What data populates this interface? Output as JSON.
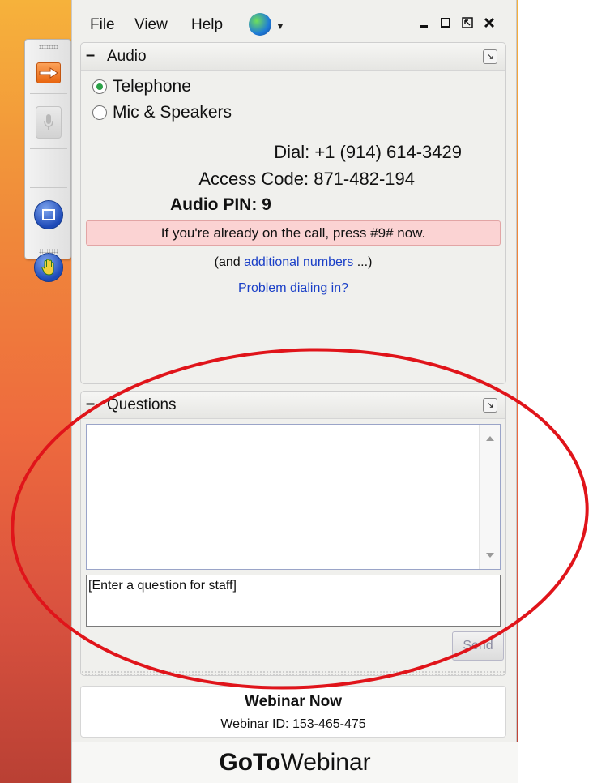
{
  "menubar": {
    "file": "File",
    "view": "View",
    "help": "Help"
  },
  "audio": {
    "title": "Audio",
    "options": [
      "Telephone",
      "Mic & Speakers"
    ],
    "selected": "Telephone",
    "dial": "Dial: +1 (914) 614-3429",
    "access_code": "Access Code: 871-482-194",
    "pin": "Audio PIN: 9",
    "alert": "If you're already on the call, press #9# now.",
    "additional_prefix": "(and ",
    "additional_link": "additional numbers",
    "additional_suffix": " ...)",
    "problem_link": "Problem dialing in?"
  },
  "questions": {
    "title": "Questions",
    "input_value": "[Enter a question for staff]",
    "send_label": "Send"
  },
  "webinar": {
    "title": "Webinar Now",
    "id": "Webinar ID: 153-465-475"
  },
  "brand": {
    "goto": "GoTo",
    "webinar": "Webinar"
  },
  "colors": {
    "accent_orange": "#e8650f",
    "link_blue": "#1a3fc7",
    "alert_bg": "#fbd3d3",
    "annotation_red": "#e0141a"
  },
  "icons": [
    "arrow-icon",
    "mic-icon",
    "screen-icon",
    "raise-hand-icon",
    "globe-icon",
    "minimize-icon",
    "maximize-icon",
    "restore-icon",
    "close-icon",
    "popout-icon"
  ]
}
